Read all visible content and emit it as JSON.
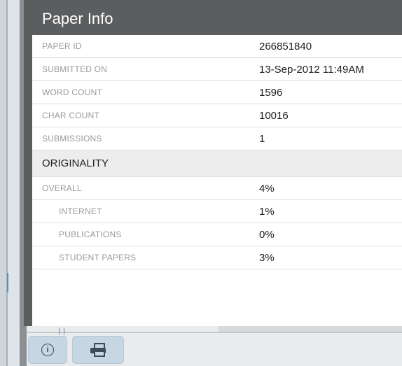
{
  "panel": {
    "title": "Paper Info"
  },
  "info_rows": [
    {
      "label": "PAPER ID",
      "value": "266851840"
    },
    {
      "label": "SUBMITTED ON",
      "value": "13-Sep-2012 11:49AM"
    },
    {
      "label": "WORD COUNT",
      "value": "1596"
    },
    {
      "label": "CHAR COUNT",
      "value": "10016"
    },
    {
      "label": "SUBMISSIONS",
      "value": "1"
    }
  ],
  "originality": {
    "heading": "ORIGINALITY",
    "overall": {
      "label": "OVERALL",
      "value": "4%"
    },
    "breakdown": [
      {
        "label": "INTERNET",
        "value": "1%"
      },
      {
        "label": "PUBLICATIONS",
        "value": "0%"
      },
      {
        "label": "STUDENT PAPERS",
        "value": "3%"
      }
    ]
  },
  "toolbar": {
    "info_icon": "info-icon",
    "print_icon": "print-icon"
  }
}
